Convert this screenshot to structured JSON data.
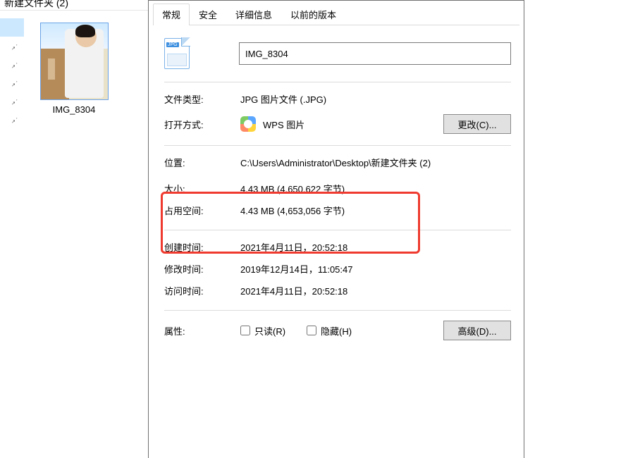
{
  "explorer": {
    "folder_title": "新建文件夹 (2)",
    "thumbnail_label": "IMG_8304"
  },
  "dialog": {
    "tabs": [
      "常规",
      "安全",
      "详细信息",
      "以前的版本"
    ],
    "filename": "IMG_8304",
    "file_icon_badge": "JPG",
    "rows": {
      "type_label": "文件类型:",
      "type_value": "JPG 图片文件 (.JPG)",
      "open_with_label": "打开方式:",
      "open_with_app": "WPS 图片",
      "change_btn": "更改(C)...",
      "location_label": "位置:",
      "location_value": "C:\\Users\\Administrator\\Desktop\\新建文件夹 (2)",
      "size_label": "大小:",
      "size_value": "4.43 MB (4,650,622 字节)",
      "size_on_disk_label": "占用空间:",
      "size_on_disk_value": "4.43 MB (4,653,056 字节)",
      "created_label": "创建时间:",
      "created_value": "2021年4月11日，20:52:18",
      "modified_label": "修改时间:",
      "modified_value": "2019年12月14日，11:05:47",
      "accessed_label": "访问时间:",
      "accessed_value": "2021年4月11日，20:52:18",
      "attributes_label": "属性:",
      "readonly_label": "只读(R)",
      "hidden_label": "隐藏(H)",
      "advanced_btn": "高级(D)..."
    }
  }
}
